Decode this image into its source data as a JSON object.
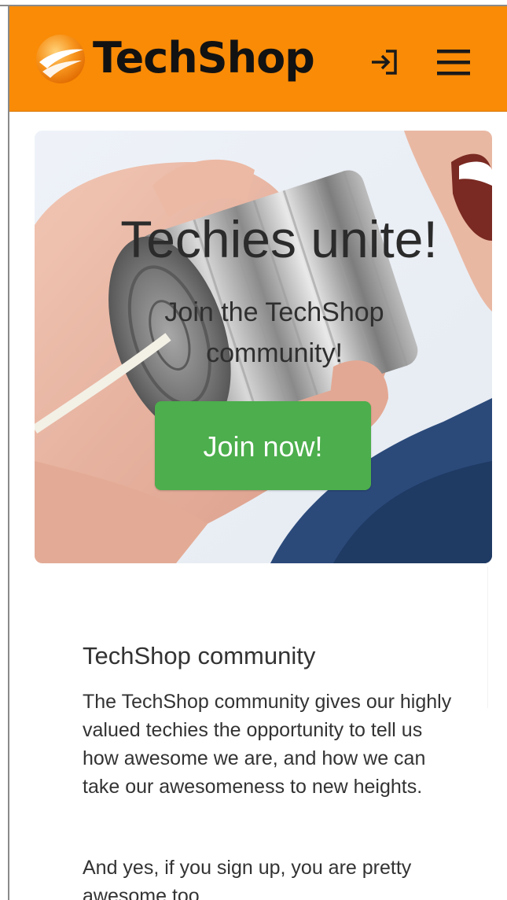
{
  "header": {
    "brand": "TechShop",
    "login_icon": "login-icon",
    "menu_icon": "hamburger-menu-icon",
    "background_color": "#f98b06"
  },
  "hero": {
    "title": "Techies unite!",
    "subtitle": "Join the TechShop community!",
    "cta_label": "Join now!",
    "cta_color": "#4cae4c"
  },
  "community": {
    "title": "TechShop community",
    "paragraphs": [
      "The TechShop community gives our highly valued techies the opportunity to tell us how awesome we are, and how we can take our awesomeness to new heights.",
      "And yes, if you sign up, you are pretty awesome too."
    ]
  }
}
